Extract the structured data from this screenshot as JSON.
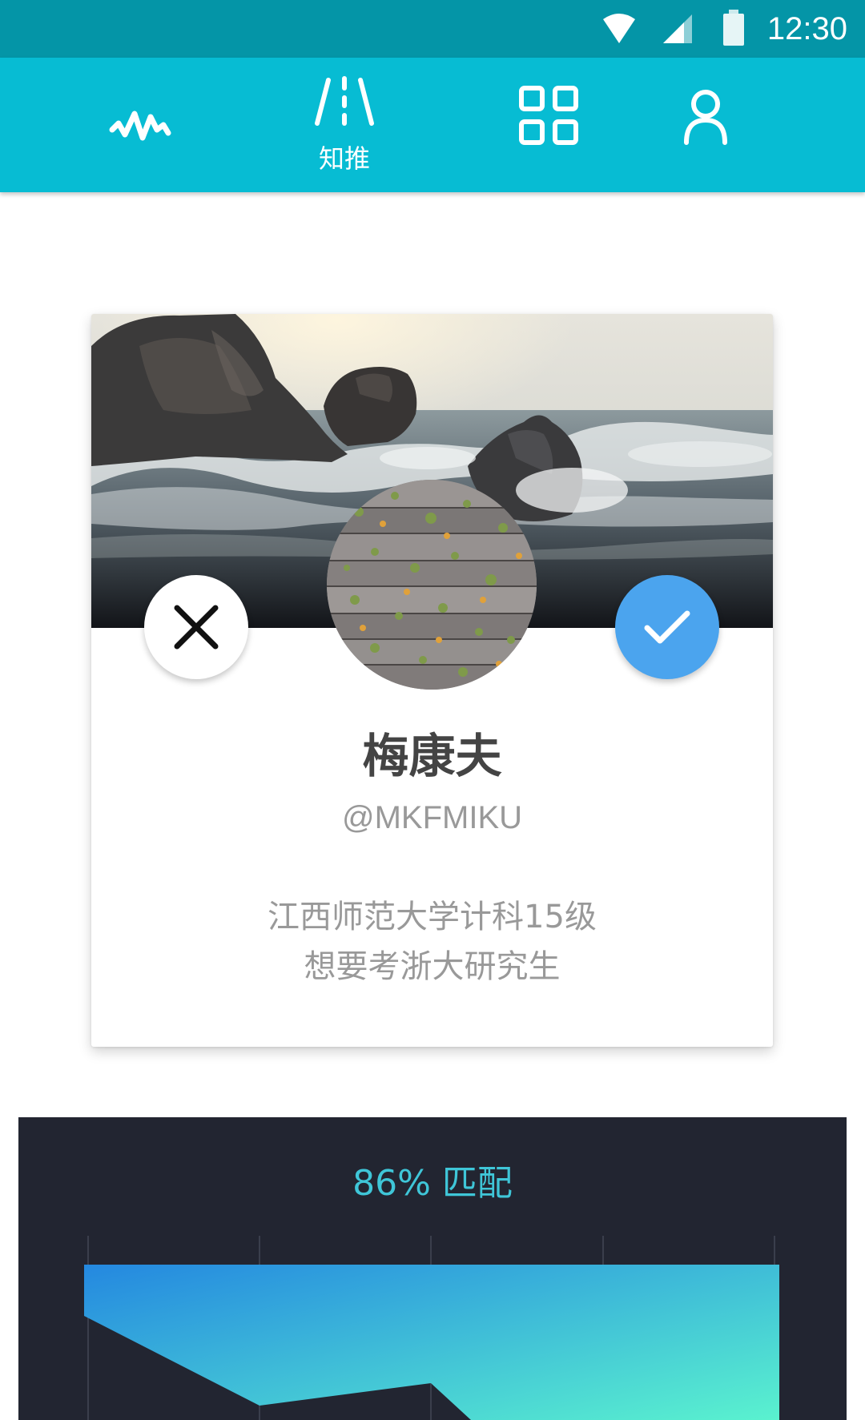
{
  "status_bar": {
    "time": "12:30"
  },
  "top_nav": {
    "items": [
      {
        "icon": "pulse-icon",
        "label": ""
      },
      {
        "icon": "road-icon",
        "label": "知推"
      },
      {
        "icon": "grid-icon",
        "label": ""
      },
      {
        "icon": "person-icon",
        "label": ""
      }
    ]
  },
  "profile_card": {
    "name": "梅康夫",
    "handle": "@MKFMIKU",
    "bio": [
      "江西师范大学计科15级",
      "想要考浙大研究生"
    ],
    "reject_icon": "close-icon",
    "accept_icon": "check-icon"
  },
  "match": {
    "title": "86% 匹配",
    "percent": 86,
    "colors": {
      "start": "#2488e0",
      "end": "#5af2cf",
      "background": "#222531"
    }
  }
}
